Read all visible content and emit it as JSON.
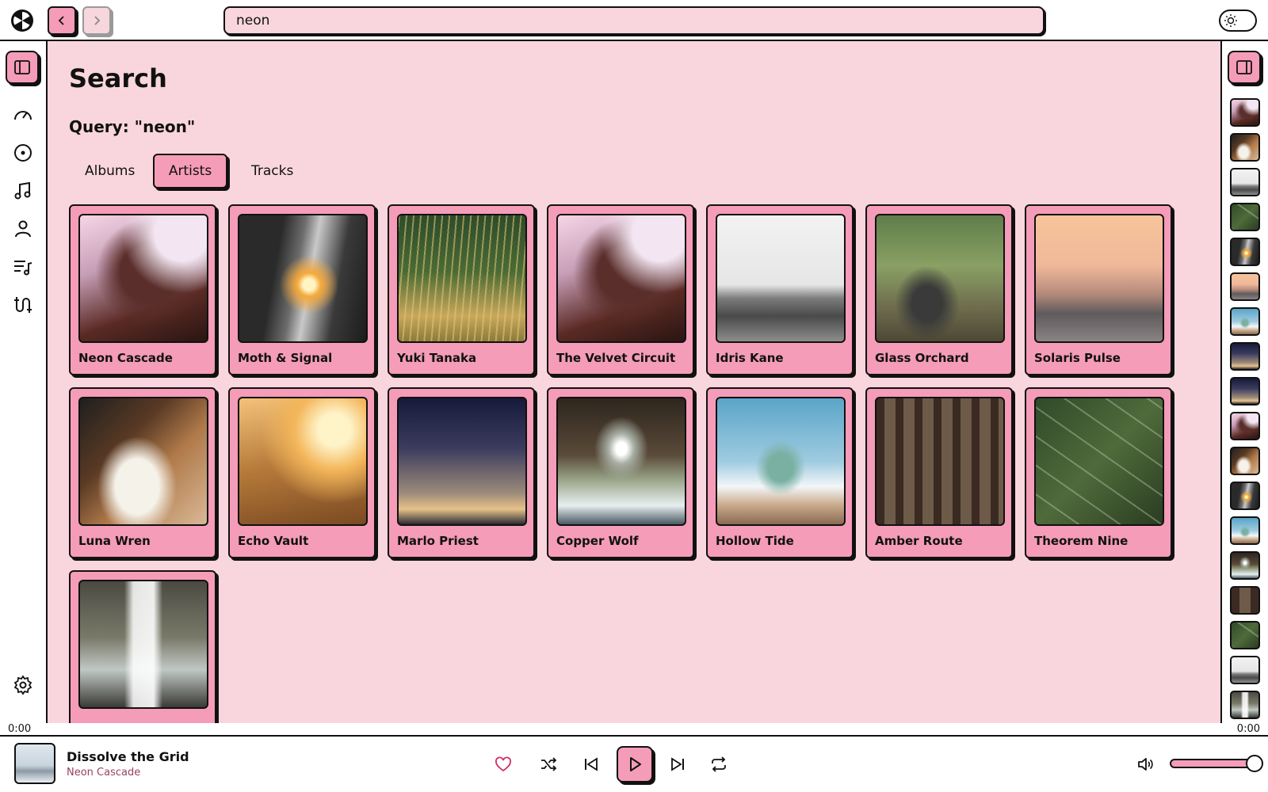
{
  "search": {
    "value": "neon"
  },
  "main": {
    "title": "Search",
    "query_label": "Query: \"neon\"",
    "tabs": [
      {
        "label": "Albums",
        "active": false
      },
      {
        "label": "Artists",
        "active": true
      },
      {
        "label": "Tracks",
        "active": false
      }
    ],
    "artists": [
      {
        "name": "Neon Cascade",
        "art": "portrait-sunset"
      },
      {
        "name": "Moth & Signal",
        "art": "train-platform"
      },
      {
        "name": "Yuki Tanaka",
        "art": "tall-grass"
      },
      {
        "name": "The Velvet Circuit",
        "art": "portrait-sunset"
      },
      {
        "name": "Idris Kane",
        "art": "bridge-mono"
      },
      {
        "name": "Glass Orchard",
        "art": "swings"
      },
      {
        "name": "Solaris Pulse",
        "art": "golden-gate"
      },
      {
        "name": "Luna Wren",
        "art": "notebook-writing"
      },
      {
        "name": "Echo Vault",
        "art": "golden-field"
      },
      {
        "name": "Marlo Priest",
        "art": "dusk-gradient"
      },
      {
        "name": "Copper Wolf",
        "art": "pier-waves"
      },
      {
        "name": "Hollow Tide",
        "art": "statue-liberty"
      },
      {
        "name": "Amber Route",
        "art": "forest-path"
      },
      {
        "name": "Theorem Nine",
        "art": "aerial-green"
      },
      {
        "name": "",
        "art": "waterfall-rainbow"
      }
    ]
  },
  "player": {
    "time_elapsed": "0:00",
    "time_total": "0:00",
    "track_title": "Dissolve the Grid",
    "track_artist": "Neon Cascade",
    "volume": 1.0
  },
  "icons": {
    "sidebar": [
      "dashboard-icon",
      "disc-icon",
      "music-note-icon",
      "user-icon",
      "playlist-icon",
      "tracks-icon",
      "settings-icon"
    ],
    "player": [
      "heart-icon",
      "shuffle-icon",
      "skip-back-icon",
      "play-icon",
      "skip-forward-icon",
      "repeat-icon",
      "volume-icon"
    ]
  },
  "colors": {
    "accent": "#f49cb8",
    "background": "#f9d6dd",
    "border": "#111111"
  }
}
